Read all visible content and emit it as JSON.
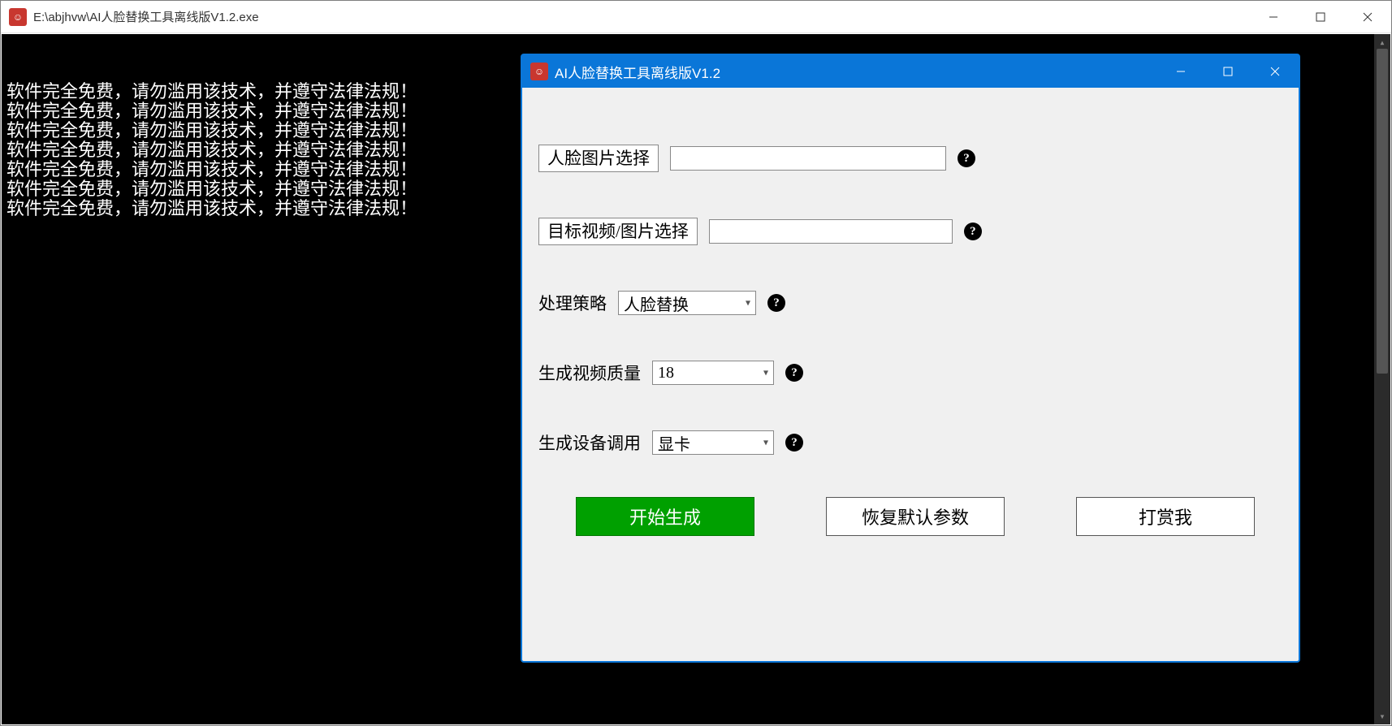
{
  "outer": {
    "title": "E:\\abjhvw\\AI人脸替换工具离线版V1.2.exe"
  },
  "console": {
    "line": "软件完全免费，请勿滥用该技术，并遵守法律法规！",
    "repeat": 7
  },
  "dialog": {
    "title": "AI人脸替换工具离线版V1.2",
    "fields": {
      "face_image": {
        "button": "人脸图片选择",
        "value": ""
      },
      "target": {
        "button": "目标视频/图片选择",
        "value": ""
      },
      "strategy": {
        "label": "处理策略",
        "value": "人脸替换"
      },
      "quality": {
        "label": "生成视频质量",
        "value": "18"
      },
      "device": {
        "label": "生成设备调用",
        "value": "显卡"
      }
    },
    "buttons": {
      "start": "开始生成",
      "reset": "恢复默认参数",
      "donate": "打赏我"
    },
    "help_glyph": "?"
  }
}
